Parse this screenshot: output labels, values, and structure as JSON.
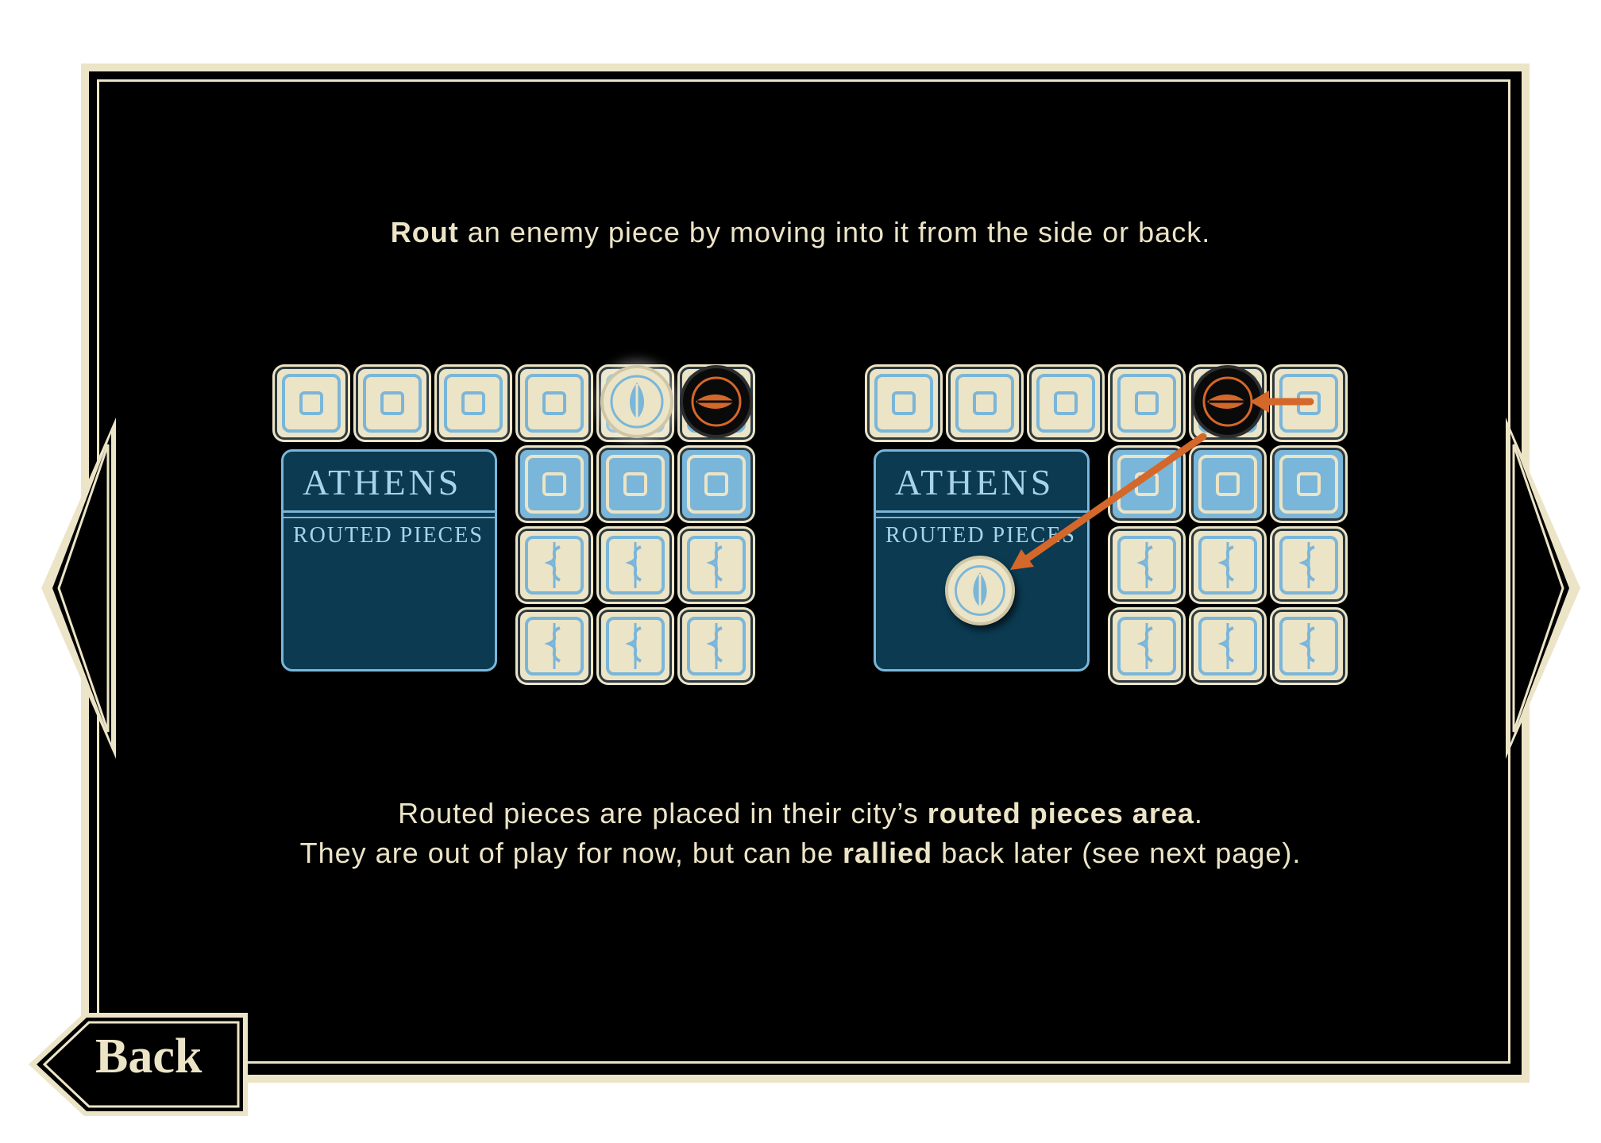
{
  "tutorial": {
    "headline_bold": "Rout",
    "headline_rest": " an enemy piece by moving into it from the side or back.",
    "body_line1_pre": "Routed pieces are placed in their city’s ",
    "body_line1_bold": "routed pieces area",
    "body_line1_post": ".",
    "body_line2_pre": "They are out of play for now, but can be ",
    "body_line2_bold": "rallied",
    "body_line2_post": " back later (see next page)."
  },
  "boards": [
    {
      "city_name": "ATHENS",
      "area_label": "ROUTED PIECES"
    },
    {
      "city_name": "ATHENS",
      "area_label": "ROUTED PIECES"
    }
  ],
  "navigation": {
    "back_label": "Back",
    "prev_icon": "left-arrow-icon",
    "next_icon": "right-arrow-icon"
  },
  "colors": {
    "cream": "#ece4c6",
    "light_blue": "#7ab6d9",
    "navy": "#0b3a51",
    "enemy_orange": "#d4672a",
    "background": "#000000"
  }
}
